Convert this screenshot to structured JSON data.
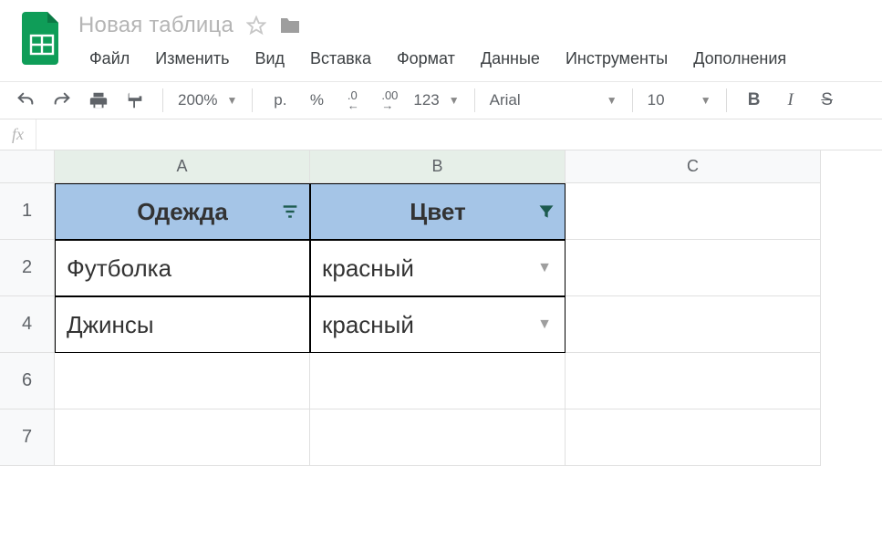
{
  "doc": {
    "title": "Новая таблица"
  },
  "menus": [
    "Файл",
    "Изменить",
    "Вид",
    "Вставка",
    "Формат",
    "Данные",
    "Инструменты",
    "Дополнения"
  ],
  "toolbar": {
    "zoom": "200%",
    "currency": "р.",
    "percent": "%",
    "dec_less": ".0",
    "dec_more": ".00",
    "num_format": "123",
    "font": "Arial",
    "size": "10"
  },
  "formula_bar": {
    "fx": "fx",
    "value": ""
  },
  "columns": [
    "A",
    "B",
    "C"
  ],
  "row_labels": [
    "1",
    "2",
    "4",
    "6",
    "7"
  ],
  "table": {
    "headers": {
      "a": "Одежда",
      "b": "Цвет"
    },
    "rows": [
      {
        "a": "Футболка",
        "b": "красный"
      },
      {
        "a": "Джинсы",
        "b": "красный"
      }
    ]
  }
}
